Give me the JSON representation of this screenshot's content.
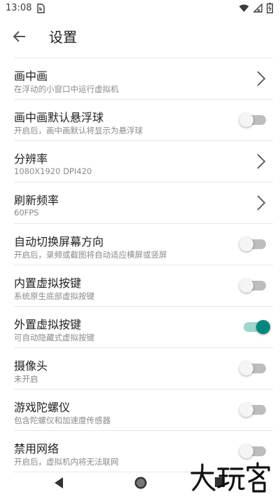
{
  "status_bar": {
    "time": "13:08"
  },
  "header": {
    "title": "设置"
  },
  "settings": [
    {
      "title": "画中画",
      "subtitle": "在浮动的小窗口中运行虚拟机",
      "control": "chevron"
    },
    {
      "title": "画中画默认悬浮球",
      "subtitle": "开启后，画中画默认将显示为悬浮球",
      "control": "toggle",
      "on": false
    },
    {
      "title": "分辨率",
      "subtitle": "1080X1920 DPI420",
      "control": "chevron"
    },
    {
      "title": "刷新频率",
      "subtitle": "60FPS",
      "control": "chevron"
    },
    {
      "title": "自动切换屏幕方向",
      "subtitle": "开启后，录频或截图将自动适应横屏或竖屏",
      "control": "toggle",
      "on": false
    },
    {
      "title": "内置虚拟按键",
      "subtitle": "系统原生底部虚拟按键",
      "control": "toggle",
      "on": false
    },
    {
      "title": "外置虚拟按键",
      "subtitle": "可自动隐藏式虚拟按键",
      "control": "toggle",
      "on": true
    },
    {
      "title": "摄像头",
      "subtitle": "未开启",
      "control": "toggle",
      "on": false
    },
    {
      "title": "游戏陀螺仪",
      "subtitle": "包含陀螺仪和加速度传感器",
      "control": "toggle",
      "on": false
    },
    {
      "title": "禁用网络",
      "subtitle": "开启后，虚拟机内将无法联网",
      "control": "toggle",
      "on": false
    }
  ],
  "colors": {
    "accent": "#00897b",
    "accent_track": "#9fd7cf",
    "divider": "#e6e6e6",
    "subtitle": "#8a8a8a"
  },
  "watermark": {
    "text": "大玩客"
  }
}
